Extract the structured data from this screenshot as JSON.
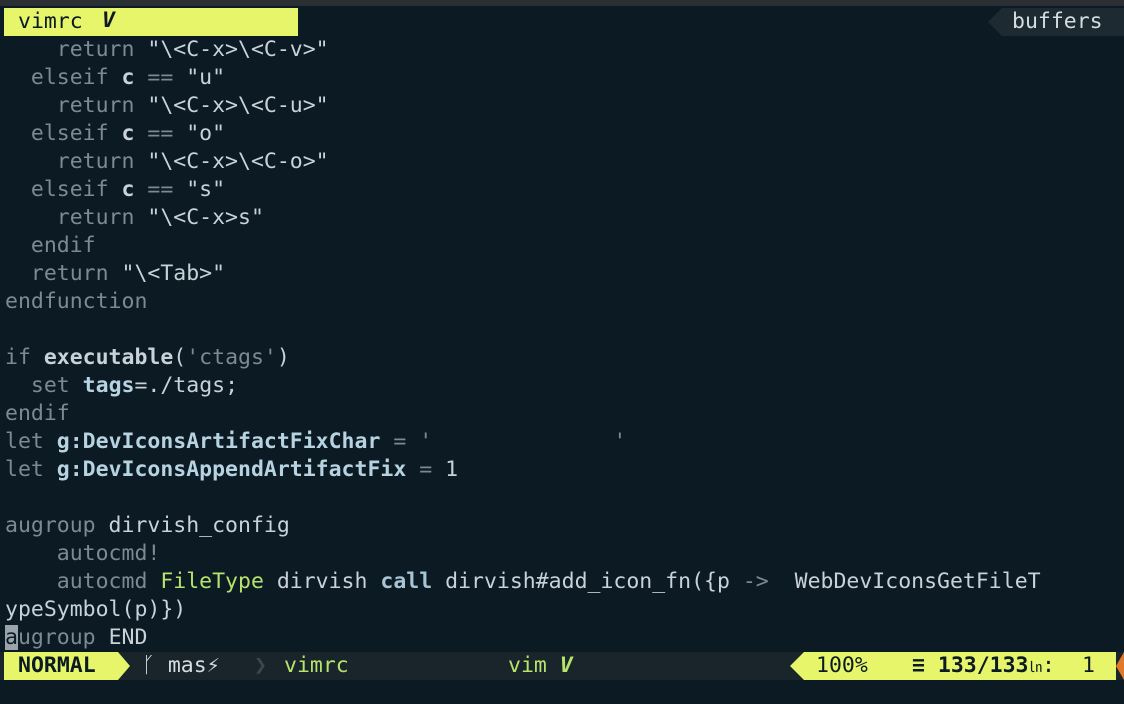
{
  "tabline": {
    "active_tab": "vimrc",
    "active_logo": "V",
    "buffers_label": "buffers"
  },
  "code": {
    "l1": {
      "kw": "    return",
      "str": " \"\\<C-x>\\<C-v>\""
    },
    "l2": {
      "kw": "  elseif",
      "v": " c",
      "op": " ==",
      "str": " \"u\""
    },
    "l3": {
      "kw": "    return",
      "str": " \"\\<C-x>\\<C-u>\""
    },
    "l4": {
      "kw": "  elseif",
      "v": " c",
      "op": " ==",
      "str": " \"o\""
    },
    "l5": {
      "kw": "    return",
      "str": " \"\\<C-x>\\<C-o>\""
    },
    "l6": {
      "kw": "  elseif",
      "v": " c",
      "op": " ==",
      "str": " \"s\""
    },
    "l7": {
      "kw": "    return",
      "str": " \"\\<C-x>s\""
    },
    "l8": {
      "kw": "  endif"
    },
    "l9": {
      "kw": "  return",
      "str": " \"\\<Tab>\""
    },
    "l10": {
      "kw": "endfunction"
    },
    "l11": {},
    "l12": {
      "kw": "if",
      "fn": " executable",
      "p1": "(",
      "sq": "'ctags'",
      "p2": ")"
    },
    "l13": {
      "kw": "  set",
      "opt": " tags",
      "rest": "=./tags;"
    },
    "l14": {
      "kw": "endif"
    },
    "l15": {
      "kw": "let",
      "var": " g:DevIconsArtifactFixChar",
      "op": " = ",
      "sq": "'              '"
    },
    "l16": {
      "kw": "let",
      "var": " g:DevIconsAppendArtifactFix",
      "op": " = ",
      "num": "1"
    },
    "l17": {},
    "l18": {
      "kw": "augroup",
      "rest": " dirvish_config"
    },
    "l19": {
      "kw": "    autocmd!"
    },
    "l20": {
      "kw": "    autocmd",
      "ev": " FileType",
      "rest": " dirvish",
      "call": " call",
      "fn": " dirvish#add_icon_fn({p",
      "op": " ->",
      "tail": "  WebDevIconsGetFileT"
    },
    "l21": {
      "rest": "ypeSymbol(p)})"
    },
    "l22": {
      "cur": "a",
      "kw": "ugroup",
      "rest": " END"
    }
  },
  "status": {
    "mode": "NORMAL",
    "branch_icon": "ᚴ",
    "branch": "mas⚡",
    "separator": "❯",
    "filename": "vimrc",
    "filetype": "vim",
    "filetype_logo": "V",
    "percent": "100%",
    "position": "≡ 133/133",
    "ln_icon": "㏑",
    "col_sep": ":",
    "column": "1"
  },
  "colors": {
    "background": "#0b1a23",
    "accent": "#e6f56a",
    "green": "#b6e36a",
    "keyword": "#7d8a92",
    "warning": "#e07a2a"
  }
}
